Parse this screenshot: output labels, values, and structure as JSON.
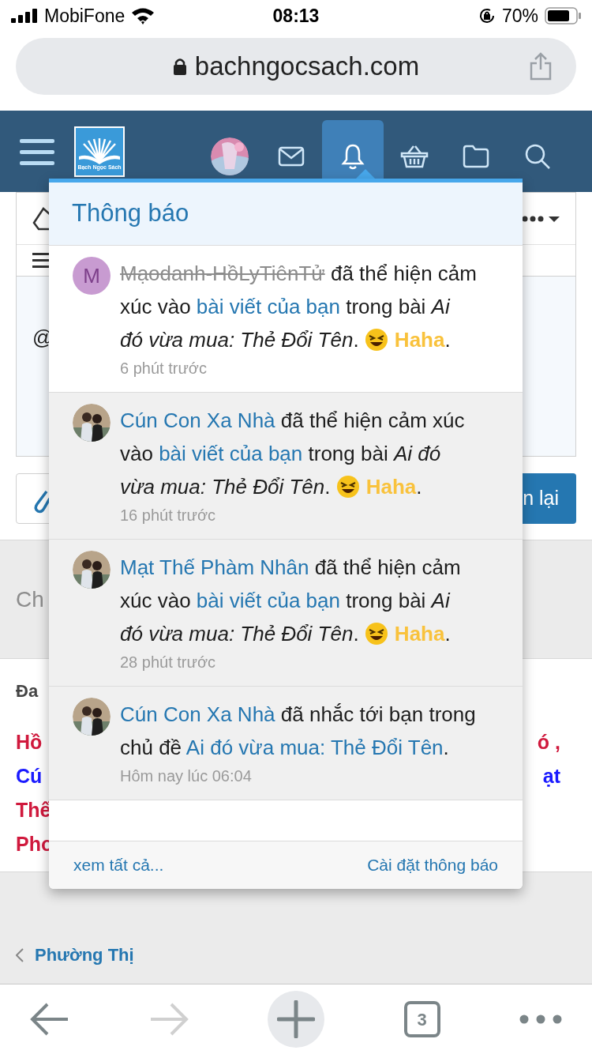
{
  "status_bar": {
    "carrier": "MobiFone",
    "time": "08:13",
    "battery": "70%"
  },
  "address_bar": {
    "url": "bachngocsach.com"
  },
  "site_nav": {
    "logo_text": "Bạch Ngọc Sách",
    "tabs": [
      {
        "kind": "avatar",
        "selected": false
      },
      {
        "kind": "mail",
        "selected": false
      },
      {
        "kind": "bell",
        "selected": true
      },
      {
        "kind": "basket",
        "selected": false
      },
      {
        "kind": "folder",
        "selected": false
      },
      {
        "kind": "search",
        "selected": false
      }
    ]
  },
  "page": {
    "editor_text": "@",
    "send_button": "n lại",
    "section_text": "Ch",
    "heading": "Đa",
    "lines": [
      {
        "left": "Hồ",
        "right": "ó ,",
        "color": "#d0193d"
      },
      {
        "left": "Cú",
        "right": "ạt",
        "color": "#1a1aff"
      },
      {
        "left": "Thế",
        "color": "#d0193d"
      },
      {
        "left": "Pho",
        "color": "#d0193d"
      }
    ],
    "breadcrumb": "Phường Thị"
  },
  "notifications": {
    "title": "Thông báo",
    "items": [
      {
        "highlighted": true,
        "avatar": {
          "kind": "letter",
          "letter": "M",
          "color": "#c89bd1"
        },
        "parts": [
          {
            "kind": "user",
            "text": "Mạodanh-HồLyTiênTử",
            "struck": true
          },
          {
            "kind": "text",
            "text": " đã thể hiện cảm xúc vào "
          },
          {
            "kind": "link",
            "text": "bài viết của bạn"
          },
          {
            "kind": "text",
            "text": " trong bài "
          },
          {
            "kind": "title",
            "text": "Ai đó vừa mua: Thẻ Đổi Tên"
          },
          {
            "kind": "text",
            "text": ". "
          },
          {
            "kind": "reaction",
            "text": "Haha"
          },
          {
            "kind": "text",
            "text": "."
          }
        ],
        "time": "6 phút trước"
      },
      {
        "highlighted": false,
        "parts": [
          {
            "kind": "user",
            "text": "Cún Con Xa Nhà",
            "struck": false
          },
          {
            "kind": "text",
            "text": " đã thể hiện cảm xúc vào "
          },
          {
            "kind": "link",
            "text": "bài viết của bạn"
          },
          {
            "kind": "text",
            "text": " trong bài "
          },
          {
            "kind": "title",
            "text": "Ai đó vừa mua: Thẻ Đổi Tên"
          },
          {
            "kind": "text",
            "text": ". "
          },
          {
            "kind": "reaction",
            "text": "Haha"
          },
          {
            "kind": "text",
            "text": "."
          }
        ],
        "time": "16 phút trước"
      },
      {
        "highlighted": false,
        "parts": [
          {
            "kind": "user",
            "text": "Mạt Thế Phàm Nhân",
            "struck": false
          },
          {
            "kind": "text",
            "text": " đã thể hiện cảm xúc vào "
          },
          {
            "kind": "link",
            "text": "bài viết của bạn"
          },
          {
            "kind": "text",
            "text": " trong bài "
          },
          {
            "kind": "title",
            "text": "Ai đó vừa mua: Thẻ Đổi Tên"
          },
          {
            "kind": "text",
            "text": ". "
          },
          {
            "kind": "reaction",
            "text": "Haha"
          },
          {
            "kind": "text",
            "text": "."
          }
        ],
        "time": "28 phút trước"
      },
      {
        "highlighted": false,
        "parts": [
          {
            "kind": "user",
            "text": "Cún Con Xa Nhà",
            "struck": false
          },
          {
            "kind": "text",
            "text": " đã nhắc tới bạn trong chủ đề "
          },
          {
            "kind": "link",
            "text": "Ai đó vừa mua: Thẻ Đổi Tên"
          },
          {
            "kind": "text",
            "text": "."
          }
        ],
        "time": "Hôm nay lúc 06:04"
      }
    ],
    "footer_links": [
      "xem tất cả...",
      "Cài đặt thông báo"
    ]
  },
  "browser_toolbar": {
    "back_disabled": false,
    "forward_disabled": true,
    "tab_count": "3"
  }
}
